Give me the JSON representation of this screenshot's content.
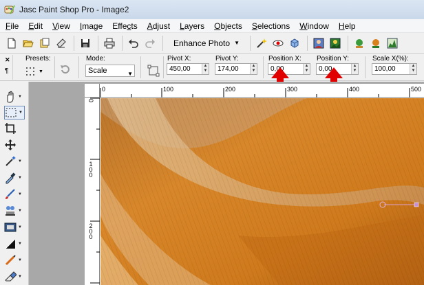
{
  "window": {
    "title": "Jasc Paint Shop Pro - Image2"
  },
  "menu": [
    "File",
    "Edit",
    "View",
    "Image",
    "Effects",
    "Adjust",
    "Layers",
    "Objects",
    "Selections",
    "Window",
    "Help"
  ],
  "menu_underline": [
    "F",
    "E",
    "V",
    "I",
    "c",
    "A",
    "L",
    "O",
    "S",
    "W",
    "H"
  ],
  "toolbar": {
    "enhance_label": "Enhance Photo"
  },
  "options": {
    "presets_label": "Presets:",
    "mode_label": "Mode:",
    "mode_value": "Scale",
    "pivot_x_label": "Pivot X:",
    "pivot_x_value": "450,00",
    "pivot_y_label": "Pivot Y:",
    "pivot_y_value": "174,00",
    "position_x_label": "Position X:",
    "position_x_value": "0,00",
    "position_y_label": "Position Y:",
    "position_y_value": "0,00",
    "scale_x_label": "Scale X(%):",
    "scale_x_value": "100,00"
  },
  "ruler": {
    "h_labels": [
      "0",
      "100",
      "200",
      "300",
      "400",
      "500"
    ],
    "v_labels": [
      "0",
      "100",
      "200"
    ]
  },
  "colors": {
    "accent_red": "#e00000",
    "canvas_orange": "#d2801e"
  }
}
